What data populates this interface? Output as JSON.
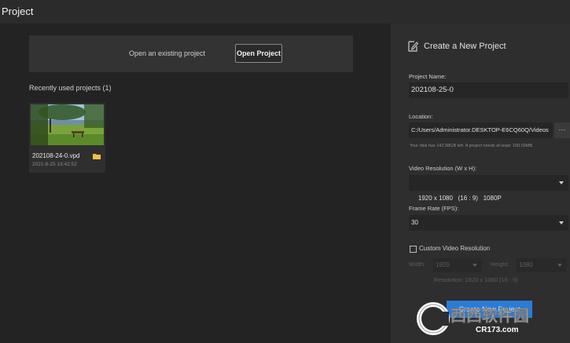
{
  "window": {
    "title": "Project"
  },
  "open_section": {
    "label": "Open an existing project",
    "button": "Open Project"
  },
  "recent": {
    "title": "Recently used projects  (1)",
    "items": [
      {
        "name": "202108-24-0.vpd",
        "date": "2021-8-25 13:42:52",
        "icon": "folder-icon"
      }
    ]
  },
  "create": {
    "title": "Create a New Project",
    "project_name_label": "Project Name:",
    "project_name_value": "202108-25-0",
    "location_label": "Location:",
    "location_value": "C:/Users/Administrator.DESKTOP-E6CQ60Q/Videos",
    "browse_label": "···",
    "disk_note": "Your disk has 142.98GB left. A project needs at least: 100.00MB.",
    "resolution_label": "Video Resolution (W x H):",
    "resolution_value": "1920 x 1080   (16 : 9)   1080P",
    "framerate_label": "Frame Rate (FPS):",
    "framerate_value": "30",
    "custom_label": "Custom Video Resolution",
    "custom_checked": false,
    "width_label": "Width:",
    "width_value": "1920",
    "height_label": "Height:",
    "height_value": "1080",
    "resolution_note": "Resolution: 1920 x 1080   (16 : 9)",
    "create_button": "Create New Project"
  },
  "watermark": {
    "brand": "西西软件园",
    "site": "CR173.com"
  },
  "colors": {
    "accent": "#2b7bd6",
    "bg": "#232323",
    "panel": "#2e2e2e"
  }
}
